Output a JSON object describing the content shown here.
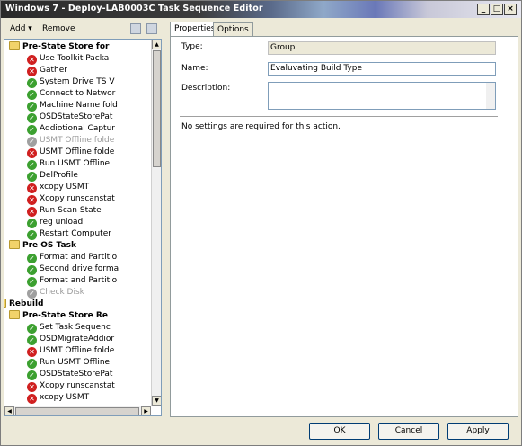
{
  "window": {
    "title": "Windows 7 - Deploy-LAB0003C Task Sequence Editor",
    "minimize": "_",
    "maximize": "□",
    "close": "×"
  },
  "toolbar": {
    "add_label": "Add",
    "remove_label": "Remove"
  },
  "tree": {
    "items": [
      {
        "label": "Pre-State Store for",
        "kind": "group",
        "status": "folder"
      },
      {
        "label": "Use Toolkit Packa",
        "kind": "step",
        "status": "err"
      },
      {
        "label": "Gather",
        "kind": "step",
        "status": "err"
      },
      {
        "label": "System Drive TS V",
        "kind": "step",
        "status": "ok"
      },
      {
        "label": "Connect to Networ",
        "kind": "step",
        "status": "ok"
      },
      {
        "label": "Machine Name fold",
        "kind": "step",
        "status": "ok"
      },
      {
        "label": "OSDStateStorePat",
        "kind": "step",
        "status": "ok"
      },
      {
        "label": "Addiotional Captur",
        "kind": "step",
        "status": "ok"
      },
      {
        "label": "USMT Offline folde",
        "kind": "step",
        "status": "dis"
      },
      {
        "label": "USMT Offline folde",
        "kind": "step",
        "status": "err"
      },
      {
        "label": "Run USMT Offline",
        "kind": "step",
        "status": "ok"
      },
      {
        "label": "DelProfile",
        "kind": "step",
        "status": "ok"
      },
      {
        "label": "xcopy USMT",
        "kind": "step",
        "status": "err"
      },
      {
        "label": "Xcopy runscanstat",
        "kind": "step",
        "status": "err"
      },
      {
        "label": "Run Scan State",
        "kind": "step",
        "status": "err"
      },
      {
        "label": "reg unload",
        "kind": "step",
        "status": "ok"
      },
      {
        "label": "Restart Computer",
        "kind": "step",
        "status": "ok"
      },
      {
        "label": "Pre OS Task",
        "kind": "group",
        "status": "folder"
      },
      {
        "label": "Format and Partitio",
        "kind": "step",
        "status": "ok"
      },
      {
        "label": "Second drive forma",
        "kind": "step",
        "status": "ok"
      },
      {
        "label": "Format and Partitio",
        "kind": "step",
        "status": "ok"
      },
      {
        "label": "Check Disk",
        "kind": "step",
        "status": "dis"
      },
      {
        "label": "Rebuild",
        "kind": "group",
        "status": "folder"
      },
      {
        "label": "Pre-State Store Re",
        "kind": "group",
        "status": "folder"
      },
      {
        "label": "Set Task Sequenc",
        "kind": "step",
        "status": "ok"
      },
      {
        "label": "OSDMigrateAddior",
        "kind": "step",
        "status": "ok"
      },
      {
        "label": "USMT Offline folde",
        "kind": "step",
        "status": "err"
      },
      {
        "label": "Run USMT Offline",
        "kind": "step",
        "status": "ok"
      },
      {
        "label": "OSDStateStorePat",
        "kind": "step",
        "status": "ok"
      },
      {
        "label": "Xcopy runscanstat",
        "kind": "step",
        "status": "err"
      },
      {
        "label": "xcopy USMT",
        "kind": "step",
        "status": "err"
      }
    ]
  },
  "tabs": [
    {
      "label": "Properties"
    },
    {
      "label": "Options"
    }
  ],
  "properties": {
    "type_label": "Type:",
    "type_value": "Group",
    "name_label": "Name:",
    "name_value": "Evaluvating Build Type",
    "description_label": "Description:",
    "description_value": "",
    "note": "No settings are required  for this action."
  },
  "buttons": {
    "ok": "OK",
    "cancel": "Cancel",
    "apply": "Apply"
  },
  "colors": {
    "ok": "#3ca030",
    "error": "#d02020",
    "disabled": "#a0a0a0"
  }
}
